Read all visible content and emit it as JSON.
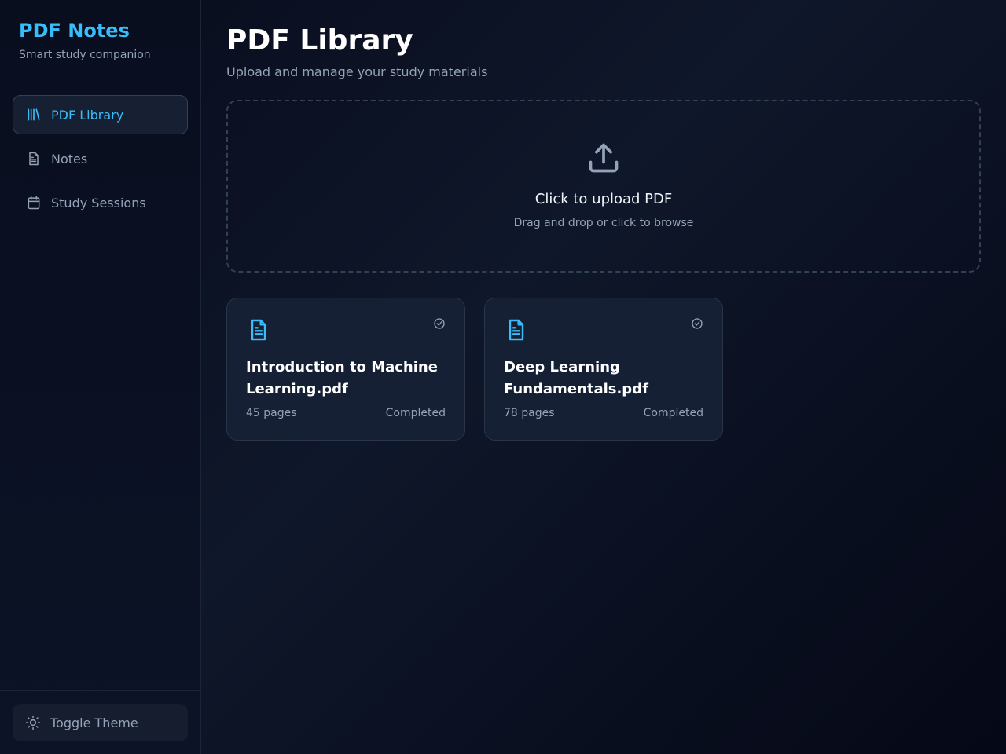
{
  "brand": {
    "title": "PDF Notes",
    "subtitle": "Smart study companion"
  },
  "nav": {
    "items": [
      {
        "label": "PDF Library",
        "icon": "library-icon",
        "active": true
      },
      {
        "label": "Notes",
        "icon": "file-text-icon",
        "active": false
      },
      {
        "label": "Study Sessions",
        "icon": "calendar-icon",
        "active": false
      }
    ]
  },
  "footer": {
    "toggle_theme_label": "Toggle Theme",
    "icon": "sun-icon"
  },
  "main": {
    "title": "PDF Library",
    "subtitle": "Upload and manage your study materials",
    "upload": {
      "title": "Click to upload PDF",
      "hint": "Drag and drop or click to browse",
      "icon": "upload-icon"
    },
    "documents": [
      {
        "name": "Introduction to Machine Learning.pdf",
        "pages": "45 pages",
        "status": "Completed"
      },
      {
        "name": "Deep Learning Fundamentals.pdf",
        "pages": "78 pages",
        "status": "Completed"
      }
    ]
  },
  "colors": {
    "accent": "#38bdf8",
    "background": "#0b1020",
    "card": "#162034",
    "muted_text": "#94a3b8"
  }
}
